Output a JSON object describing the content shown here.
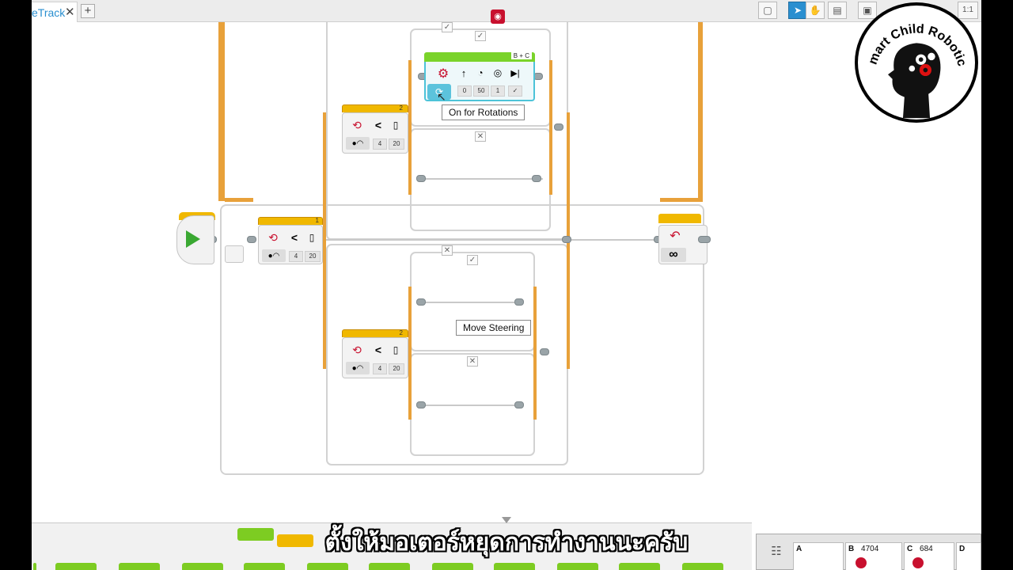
{
  "tabs": [
    {
      "label": "eTrack",
      "close": "✕"
    }
  ],
  "tab_add": "+",
  "toolbar": {
    "icons": [
      "new-file-icon",
      "select-pointer-icon",
      "pan-hand-icon",
      "comment-icon",
      "save-icon",
      "zoom-reset-icon"
    ],
    "zoom_label": "1:1"
  },
  "blocks": {
    "switch_main": {
      "port_number": "1",
      "operator": "<",
      "value_a": "4",
      "value_b": "20"
    },
    "switch_upper": {
      "port_number": "2",
      "operator": "<",
      "value_a": "4",
      "value_b": "20"
    },
    "switch_lower": {
      "port_number": "2",
      "operator": "<",
      "value_a": "4",
      "value_b": "20"
    },
    "move_steering": {
      "ports": "B + C",
      "steering": "0",
      "power": "50",
      "rotations": "1",
      "brake": "✓"
    },
    "loop_end": {
      "mode_symbol": "∞"
    }
  },
  "case_flags": {
    "check": "✓",
    "cross": "✕"
  },
  "tooltips": {
    "on_for_rotations": "On for Rotations",
    "move_steering": "Move Steering"
  },
  "logo": {
    "text": "Smart Child Robotics"
  },
  "hardware": {
    "ports": [
      {
        "label": "A",
        "value": ""
      },
      {
        "label": "B",
        "value": "4704"
      },
      {
        "label": "C",
        "value": "684"
      },
      {
        "label": "D",
        "value": ""
      }
    ]
  },
  "subtitle": "ตั้งให้มอเตอร์หยุดการทำงานนะครับ",
  "colors": {
    "accent": "#2a8fd0",
    "wire": "#e8a13a",
    "block_header": "#f0b800",
    "palette_green": "#7dcc22"
  }
}
